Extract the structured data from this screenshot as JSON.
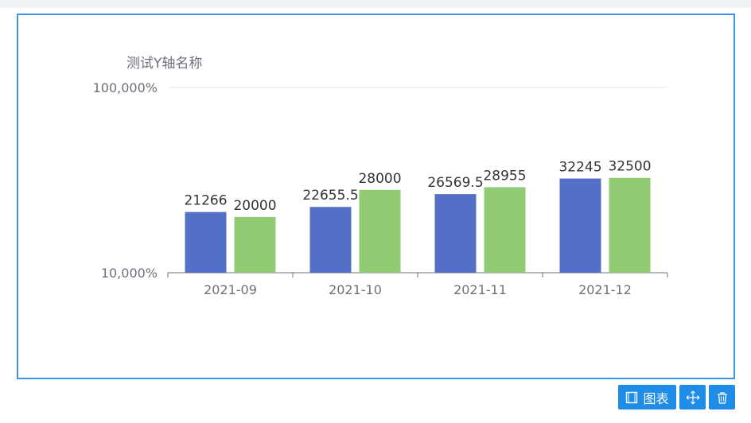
{
  "colors": {
    "series1": "#5470c6",
    "series2": "#91cc75",
    "frame": "#3d95e8",
    "toolbar": "#1f8ce8"
  },
  "toolbar": {
    "chart_label": "图表",
    "chart_icon": "frame-icon",
    "move_icon": "move-icon",
    "delete_icon": "trash-icon"
  },
  "chart_data": {
    "type": "bar",
    "ylabel": "测试Y轴名称",
    "yscale": "log",
    "ylim": [
      10000,
      100000
    ],
    "yticks": [
      "10,000%",
      "100,000%"
    ],
    "categories": [
      "2021-09",
      "2021-10",
      "2021-11",
      "2021-12"
    ],
    "series": [
      {
        "values": [
          21266,
          22655.5,
          26569.5,
          32245
        ]
      },
      {
        "values": [
          20000,
          28000,
          28955,
          32500
        ]
      }
    ],
    "data_labels": [
      [
        "21266",
        "22655.5",
        "26569.5",
        "32245"
      ],
      [
        "20000",
        "28000",
        "28955",
        "32500"
      ]
    ],
    "grid": true,
    "legend": "none"
  }
}
